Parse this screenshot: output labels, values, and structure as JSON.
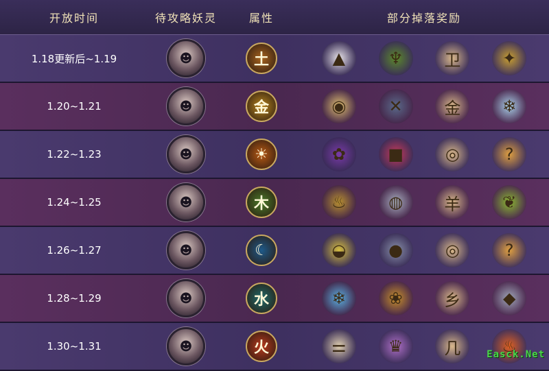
{
  "header": {
    "time": "开放时间",
    "demon": "待攻略妖灵",
    "attribute": "属性",
    "drops": "部分掉落奖励"
  },
  "rows": [
    {
      "time": "1.18更新后~1.19",
      "demon_icon": "red-haired-demon-portrait-icon",
      "attr_icon": "earth-attribute-icon",
      "attr_glyph": "土",
      "attr_color": "#a8641e",
      "drops": [
        {
          "icon": "white-powder-pile-icon",
          "glyph": "▲",
          "color": "#e8e4e8"
        },
        {
          "icon": "green-bronze-vessel-icon",
          "glyph": "♆",
          "color": "#5c8a2a"
        },
        {
          "icon": "rune-stone-icon",
          "glyph": "卫",
          "color": "#d9b88a"
        },
        {
          "icon": "golden-ore-icon",
          "glyph": "✦",
          "color": "#c9a030"
        }
      ]
    },
    {
      "time": "1.20~1.21",
      "demon_icon": "white-haired-demon-portrait-icon",
      "attr_icon": "metal-attribute-icon",
      "attr_glyph": "金",
      "attr_color": "#b8861e",
      "drops": [
        {
          "icon": "crystal-orb-stand-icon",
          "glyph": "◉",
          "color": "#e0c070"
        },
        {
          "icon": "blue-crossbow-icon",
          "glyph": "✕",
          "color": "#5a6a8a"
        },
        {
          "icon": "rune-stone-icon",
          "glyph": "金",
          "color": "#d9b88a"
        },
        {
          "icon": "ice-crystal-orb-icon",
          "glyph": "❄",
          "color": "#a8d0e8"
        }
      ]
    },
    {
      "time": "1.22~1.23",
      "demon_icon": "hooded-demon-portrait-icon",
      "attr_icon": "sun-attribute-icon",
      "attr_glyph": "☀",
      "attr_color": "#b85a14",
      "drops": [
        {
          "icon": "purple-feather-icon",
          "glyph": "✿",
          "color": "#7a3aa8"
        },
        {
          "icon": "red-treasure-box-icon",
          "glyph": "■",
          "color": "#c83a5a"
        },
        {
          "icon": "rune-stone-icon",
          "glyph": "◎",
          "color": "#d9b88a"
        },
        {
          "icon": "question-mark-icon",
          "glyph": "?",
          "color": "#e0a040"
        }
      ]
    },
    {
      "time": "1.24~1.25",
      "demon_icon": "black-haired-demon-portrait-icon",
      "attr_icon": "wood-attribute-icon",
      "attr_glyph": "木",
      "attr_color": "#4a7a2a",
      "drops": [
        {
          "icon": "golden-cauldron-icon",
          "glyph": "♨",
          "color": "#b89030"
        },
        {
          "icon": "silver-gourd-icon",
          "glyph": "◍",
          "color": "#a8b0c0"
        },
        {
          "icon": "rune-stone-icon",
          "glyph": "羊",
          "color": "#d9b88a"
        },
        {
          "icon": "green-leaf-stone-icon",
          "glyph": "❦",
          "color": "#8ab830"
        }
      ]
    },
    {
      "time": "1.26~1.27",
      "demon_icon": "pale-lady-demon-portrait-icon",
      "attr_icon": "moon-attribute-icon",
      "attr_glyph": "☾",
      "attr_color": "#1e5a8a",
      "drops": [
        {
          "icon": "gold-ingot-icon",
          "glyph": "◒",
          "color": "#d8c040"
        },
        {
          "icon": "dark-pearl-icon",
          "glyph": "●",
          "color": "#8890a8"
        },
        {
          "icon": "rune-stone-icon",
          "glyph": "◎",
          "color": "#d9b88a"
        },
        {
          "icon": "question-mark-icon",
          "glyph": "?",
          "color": "#e0a040"
        }
      ]
    },
    {
      "time": "1.28~1.29",
      "demon_icon": "crowned-demon-portrait-icon",
      "attr_icon": "water-attribute-icon",
      "attr_glyph": "水",
      "attr_color": "#1e6a6a",
      "drops": [
        {
          "icon": "snowflake-icon",
          "glyph": "❄",
          "color": "#5ab0e0"
        },
        {
          "icon": "golden-fruit-icon",
          "glyph": "❀",
          "color": "#c8902a"
        },
        {
          "icon": "rune-stone-icon",
          "glyph": "乡",
          "color": "#d9b88a"
        },
        {
          "icon": "silver-shard-icon",
          "glyph": "◆",
          "color": "#a0a8b8"
        }
      ]
    },
    {
      "time": "1.30~1.31",
      "demon_icon": "armored-demon-portrait-icon",
      "attr_icon": "fire-attribute-icon",
      "attr_glyph": "火",
      "attr_color": "#b83a1e",
      "drops": [
        {
          "icon": "bone-icon",
          "glyph": "⚌",
          "color": "#e0d0b0"
        },
        {
          "icon": "fox-mask-icon",
          "glyph": "♛",
          "color": "#b070c8"
        },
        {
          "icon": "rune-stone-icon",
          "glyph": "几",
          "color": "#d9b88a"
        },
        {
          "icon": "fire-flame-icon",
          "glyph": "♨",
          "color": "#e06020"
        }
      ]
    }
  ],
  "watermark": "Easck.Net"
}
